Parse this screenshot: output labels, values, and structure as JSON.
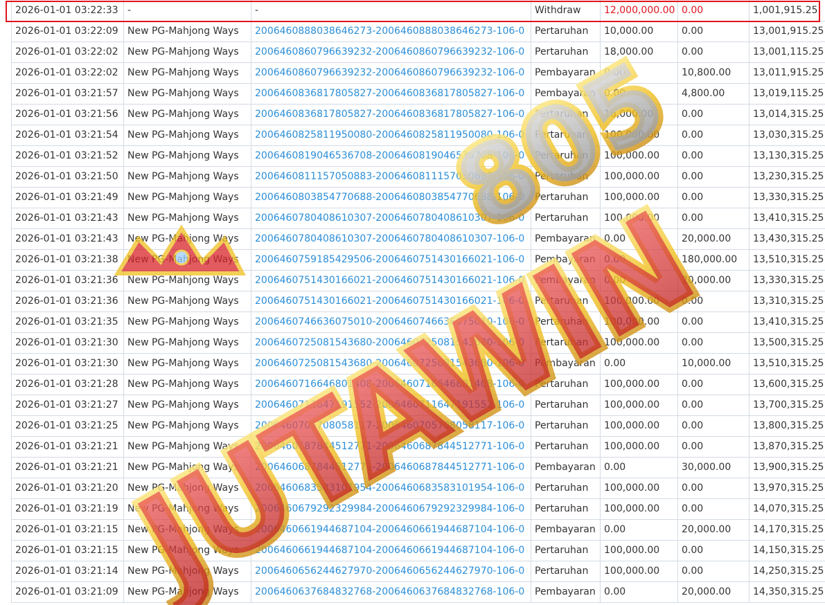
{
  "rows": [
    {
      "time": "2026-01-01 03:22:33",
      "game": "-",
      "ref": "-",
      "type": "Withdraw",
      "debit": "12,000,000.00",
      "credit": "0.00",
      "balance": "1,001,915.25"
    },
    {
      "time": "2026-01-01 03:22:09",
      "game": "New PG-Mahjong Ways",
      "ref": "2006460888038646273-2006460888038646273-106-0",
      "type": "Pertaruhan",
      "debit": "10,000.00",
      "credit": "0.00",
      "balance": "13,001,915.25"
    },
    {
      "time": "2026-01-01 03:22:02",
      "game": "New PG-Mahjong Ways",
      "ref": "2006460860796639232-2006460860796639232-106-0",
      "type": "Pertaruhan",
      "debit": "18,000.00",
      "credit": "0.00",
      "balance": "13,001,115.25"
    },
    {
      "time": "2026-01-01 03:22:02",
      "game": "New PG-Mahjong Ways",
      "ref": "2006460860796639232-2006460860796639232-106-0",
      "type": "Pembayaran",
      "debit": "0.00",
      "credit": "10,800.00",
      "balance": "13,011,915.25"
    },
    {
      "time": "2026-01-01 03:21:57",
      "game": "New PG-Mahjong Ways",
      "ref": "2006460836817805827-2006460836817805827-106-0",
      "type": "Pembayaran",
      "debit": "0.00",
      "credit": "4,800.00",
      "balance": "13,019,115.25"
    },
    {
      "time": "2026-01-01 03:21:56",
      "game": "New PG-Mahjong Ways",
      "ref": "2006460836817805827-2006460836817805827-106-0",
      "type": "Pertaruhan",
      "debit": "16,000.00",
      "credit": "0.00",
      "balance": "13,014,315.25"
    },
    {
      "time": "2026-01-01 03:21:54",
      "game": "New PG-Mahjong Ways",
      "ref": "2006460825811950080-2006460825811950080-106-0",
      "type": "Pertaruhan",
      "debit": "100,000.00",
      "credit": "0.00",
      "balance": "13,030,315.25"
    },
    {
      "time": "2026-01-01 03:21:52",
      "game": "New PG-Mahjong Ways",
      "ref": "2006460819046536708-2006460819046536708-106-0",
      "type": "Pertaruhan",
      "debit": "100,000.00",
      "credit": "0.00",
      "balance": "13,130,315.25"
    },
    {
      "time": "2026-01-01 03:21:50",
      "game": "New PG-Mahjong Ways",
      "ref": "2006460811157050883-2006460811157050883-106-0",
      "type": "Pertaruhan",
      "debit": "100,000.00",
      "credit": "0.00",
      "balance": "13,230,315.25"
    },
    {
      "time": "2026-01-01 03:21:49",
      "game": "New PG-Mahjong Ways",
      "ref": "2006460803854770688-2006460803854770688-106-0",
      "type": "Pertaruhan",
      "debit": "100,000.00",
      "credit": "0.00",
      "balance": "13,330,315.25"
    },
    {
      "time": "2026-01-01 03:21:43",
      "game": "New PG-Mahjong Ways",
      "ref": "2006460780408610307-2006460780408610307-106-0",
      "type": "Pertaruhan",
      "debit": "100,000.00",
      "credit": "0.00",
      "balance": "13,410,315.25"
    },
    {
      "time": "2026-01-01 03:21:43",
      "game": "New PG-Mahjong Ways",
      "ref": "2006460780408610307-2006460780408610307-106-0",
      "type": "Pembayaran",
      "debit": "0.00",
      "credit": "20,000.00",
      "balance": "13,430,315.25"
    },
    {
      "time": "2026-01-01 03:21:38",
      "game": "New PG-Mahjong Ways",
      "ref": "2006460759185429506-2006460751430166021-106-0",
      "type": "Pembayaran",
      "debit": "0.00",
      "credit": "180,000.00",
      "balance": "13,510,315.25"
    },
    {
      "time": "2026-01-01 03:21:36",
      "game": "New PG-Mahjong Ways",
      "ref": "2006460751430166021-2006460751430166021-106-0",
      "type": "Pembayaran",
      "debit": "0.00",
      "credit": "20,000.00",
      "balance": "13,330,315.25"
    },
    {
      "time": "2026-01-01 03:21:36",
      "game": "New PG-Mahjong Ways",
      "ref": "2006460751430166021-2006460751430166021-106-0",
      "type": "Pertaruhan",
      "debit": "100,000.00",
      "credit": "0.00",
      "balance": "13,310,315.25"
    },
    {
      "time": "2026-01-01 03:21:35",
      "game": "New PG-Mahjong Ways",
      "ref": "2006460746636075010-2006460746636075010-106-0",
      "type": "Pertaruhan",
      "debit": "100,000.00",
      "credit": "0.00",
      "balance": "13,410,315.25"
    },
    {
      "time": "2026-01-01 03:21:30",
      "game": "New PG-Mahjong Ways",
      "ref": "2006460725081543680-2006460725081543680-106-0",
      "type": "Pertaruhan",
      "debit": "100,000.00",
      "credit": "0.00",
      "balance": "13,500,315.25"
    },
    {
      "time": "2026-01-01 03:21:30",
      "game": "New PG-Mahjong Ways",
      "ref": "2006460725081543680-2006460725081543680-106-0",
      "type": "Pembayaran",
      "debit": "0.00",
      "credit": "10,000.00",
      "balance": "13,510,315.25"
    },
    {
      "time": "2026-01-01 03:21:28",
      "game": "New PG-Mahjong Ways",
      "ref": "2006460716646801408-2006460716646801408-106-0",
      "type": "Pertaruhan",
      "debit": "100,000.00",
      "credit": "0.00",
      "balance": "13,600,315.25"
    },
    {
      "time": "2026-01-01 03:21:27",
      "game": "New PG-Mahjong Ways",
      "ref": "2006460711647191552-2006460711647191552-106-0",
      "type": "Pertaruhan",
      "debit": "100,000.00",
      "credit": "0.00",
      "balance": "13,700,315.25"
    },
    {
      "time": "2026-01-01 03:21:25",
      "game": "New PG-Mahjong Ways",
      "ref": "2006460705708058117-2006460705708058117-106-0",
      "type": "Pertaruhan",
      "debit": "100,000.00",
      "credit": "0.00",
      "balance": "13,800,315.25"
    },
    {
      "time": "2026-01-01 03:21:21",
      "game": "New PG-Mahjong Ways",
      "ref": "2006460687844512771-2006460687844512771-106-0",
      "type": "Pertaruhan",
      "debit": "100,000.00",
      "credit": "0.00",
      "balance": "13,870,315.25"
    },
    {
      "time": "2026-01-01 03:21:21",
      "game": "New PG-Mahjong Ways",
      "ref": "2006460687844512771-2006460687844512771-106-0",
      "type": "Pembayaran",
      "debit": "0.00",
      "credit": "30,000.00",
      "balance": "13,900,315.25"
    },
    {
      "time": "2026-01-01 03:21:20",
      "game": "New PG-Mahjong Ways",
      "ref": "2006460683583101954-2006460683583101954-106-0",
      "type": "Pertaruhan",
      "debit": "100,000.00",
      "credit": "0.00",
      "balance": "13,970,315.25"
    },
    {
      "time": "2026-01-01 03:21:19",
      "game": "New PG-Mahjong Ways",
      "ref": "2006460679292329984-2006460679292329984-106-0",
      "type": "Pertaruhan",
      "debit": "100,000.00",
      "credit": "0.00",
      "balance": "14,070,315.25"
    },
    {
      "time": "2026-01-01 03:21:15",
      "game": "New PG-Mahjong Ways",
      "ref": "2006460661944687104-2006460661944687104-106-0",
      "type": "Pembayaran",
      "debit": "0.00",
      "credit": "20,000.00",
      "balance": "14,170,315.25"
    },
    {
      "time": "2026-01-01 03:21:15",
      "game": "New PG-Mahjong Ways",
      "ref": "2006460661944687104-2006460661944687104-106-0",
      "type": "Pertaruhan",
      "debit": "100,000.00",
      "credit": "0.00",
      "balance": "14,150,315.25"
    },
    {
      "time": "2026-01-01 03:21:14",
      "game": "New PG-Mahjong Ways",
      "ref": "2006460656244627970-2006460656244627970-106-0",
      "type": "Pertaruhan",
      "debit": "100,000.00",
      "credit": "0.00",
      "balance": "14,250,315.25"
    },
    {
      "time": "2026-01-01 03:21:09",
      "game": "New PG-Mahjong Ways",
      "ref": "2006460637684832768-2006460637684832768-106-0",
      "type": "Pembayaran",
      "debit": "0.00",
      "credit": "20,000.00",
      "balance": "14,350,315.25"
    }
  ],
  "watermark": {
    "text": "JUTAWIN805"
  },
  "colors": {
    "link": "#2b8ed8",
    "highlight": "#e0141e",
    "grid": "#d3dbe5"
  }
}
